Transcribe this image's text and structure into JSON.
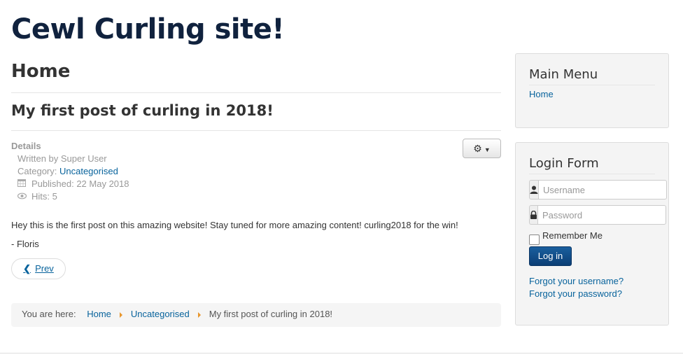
{
  "site": {
    "title": "Cewl Curling site!"
  },
  "main": {
    "page_heading": "Home",
    "article_title": "My first post of curling in 2018!",
    "details": {
      "label": "Details",
      "written_by": "Written by Super User",
      "category_prefix": "Category: ",
      "category_link": "Uncategorised",
      "published": "Published: 22 May 2018",
      "hits": "Hits: 5"
    },
    "body_text": "Hey this is the first post on this amazing website! Stay tuned for more amazing content! curling2018 for the win!",
    "signature": "- Floris",
    "prev_label": "Prev",
    "tools_icons": [
      "gear-icon",
      "caret-down-icon"
    ]
  },
  "breadcrumb": {
    "label": "You are here:",
    "items": [
      "Home",
      "Uncategorised"
    ],
    "current": "My first post of curling in 2018!",
    "separator_color": "#e8962c"
  },
  "sidebar": {
    "main_menu": {
      "title": "Main Menu",
      "items": [
        "Home"
      ]
    },
    "login": {
      "title": "Login Form",
      "username_placeholder": "Username",
      "password_placeholder": "Password",
      "remember_label": "Remember Me",
      "login_button": "Log in",
      "forgot_username": "Forgot your username?",
      "forgot_password": "Forgot your password?"
    }
  },
  "colors": {
    "link": "#08639c",
    "title": "#10223e",
    "button": "#0b3e75"
  }
}
